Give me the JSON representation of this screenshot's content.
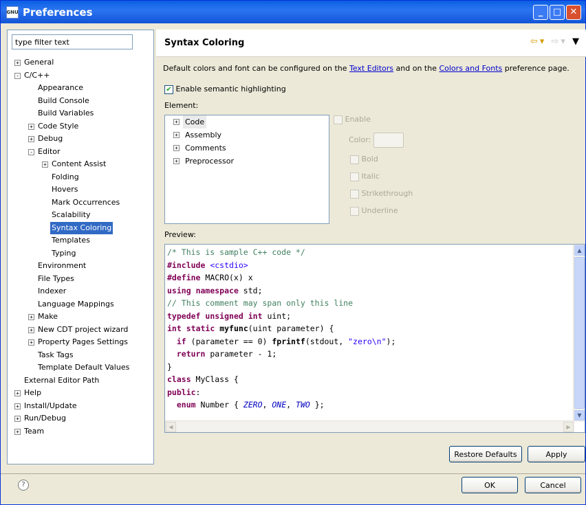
{
  "window": {
    "title": "Preferences",
    "app_icon": "app-icon-gnu",
    "controls": [
      "minimize",
      "maximize",
      "close"
    ]
  },
  "filter": {
    "placeholder": "type filter text",
    "value": "type filter text"
  },
  "tree": [
    {
      "label": "General",
      "level": 0,
      "expander": "+"
    },
    {
      "label": "C/C++",
      "level": 0,
      "expander": "-"
    },
    {
      "label": "Appearance",
      "level": 1
    },
    {
      "label": "Build Console",
      "level": 1
    },
    {
      "label": "Build Variables",
      "level": 1
    },
    {
      "label": "Code Style",
      "level": 1,
      "expander": "+"
    },
    {
      "label": "Debug",
      "level": 1,
      "expander": "+"
    },
    {
      "label": "Editor",
      "level": 1,
      "expander": "-"
    },
    {
      "label": "Content Assist",
      "level": 2,
      "expander": "+"
    },
    {
      "label": "Folding",
      "level": 2
    },
    {
      "label": "Hovers",
      "level": 2
    },
    {
      "label": "Mark Occurrences",
      "level": 2
    },
    {
      "label": "Scalability",
      "level": 2
    },
    {
      "label": "Syntax Coloring",
      "level": 2,
      "selected": true
    },
    {
      "label": "Templates",
      "level": 2
    },
    {
      "label": "Typing",
      "level": 2
    },
    {
      "label": "Environment",
      "level": 1
    },
    {
      "label": "File Types",
      "level": 1
    },
    {
      "label": "Indexer",
      "level": 1
    },
    {
      "label": "Language Mappings",
      "level": 1
    },
    {
      "label": "Make",
      "level": 1,
      "expander": "+"
    },
    {
      "label": "New CDT project wizard",
      "level": 1,
      "expander": "+"
    },
    {
      "label": "Property Pages Settings",
      "level": 1,
      "expander": "+"
    },
    {
      "label": "Task Tags",
      "level": 1
    },
    {
      "label": "Template Default Values",
      "level": 1
    },
    {
      "label": "External Editor Path",
      "level": 0
    },
    {
      "label": "Help",
      "level": 0,
      "expander": "+"
    },
    {
      "label": "Install/Update",
      "level": 0,
      "expander": "+"
    },
    {
      "label": "Run/Debug",
      "level": 0,
      "expander": "+"
    },
    {
      "label": "Team",
      "level": 0,
      "expander": "+"
    }
  ],
  "page": {
    "title": "Syntax Coloring",
    "desc_prefix": "Default colors and font can be configured on the ",
    "desc_link1": "Text Editors",
    "desc_mid": " and on the ",
    "desc_link2": "Colors and Fonts",
    "desc_suffix": " preference page.",
    "semantic_label": "Enable semantic highlighting",
    "semantic_checked": true,
    "element_label": "Element:",
    "elements": [
      "Code",
      "Assembly",
      "Comments",
      "Preprocessor"
    ],
    "options": {
      "enable": "Enable",
      "color": "Color:",
      "bold": "Bold",
      "italic": "Italic",
      "strikethrough": "Strikethrough",
      "underline": "Underline"
    },
    "preview_label": "Preview:",
    "preview_lines": [
      [
        [
          "c-com",
          "/* This is sample C++ code */"
        ]
      ],
      [
        [
          "c-pp",
          "#include"
        ],
        [
          "",
          " "
        ],
        [
          "c-inc",
          "<cstdio>"
        ]
      ],
      [
        [
          "c-pp",
          "#define"
        ],
        [
          "",
          " MACRO(x) x"
        ]
      ],
      [
        [
          "c-kw",
          "using"
        ],
        [
          "",
          " "
        ],
        [
          "c-kw",
          "namespace"
        ],
        [
          "",
          " std;"
        ]
      ],
      [
        [
          "c-com",
          "// This comment may span only this line"
        ]
      ],
      [
        [
          "c-kw",
          "typedef"
        ],
        [
          "",
          " "
        ],
        [
          "c-kw",
          "unsigned"
        ],
        [
          "",
          " "
        ],
        [
          "c-kw",
          "int"
        ],
        [
          "",
          " uint;"
        ]
      ],
      [
        [
          "c-kw",
          "int"
        ],
        [
          "",
          " "
        ],
        [
          "c-kw",
          "static"
        ],
        [
          "",
          " "
        ],
        [
          "c-fn",
          "myfunc"
        ],
        [
          "",
          "(uint parameter) {"
        ]
      ],
      [
        [
          "",
          "  "
        ],
        [
          "c-kw",
          "if"
        ],
        [
          "",
          " (parameter == 0) "
        ],
        [
          "c-fn",
          "fprintf"
        ],
        [
          "",
          "(stdout, "
        ],
        [
          "c-str",
          "\"zero\\n\""
        ],
        [
          "",
          ");"
        ]
      ],
      [
        [
          "",
          "  "
        ],
        [
          "c-kw",
          "return"
        ],
        [
          "",
          " parameter - 1;"
        ]
      ],
      [
        [
          "",
          "}"
        ]
      ],
      [
        [
          "c-kw",
          "class"
        ],
        [
          "",
          " MyClass {"
        ]
      ],
      [
        [
          "c-kw",
          "public"
        ],
        [
          "",
          ":"
        ]
      ],
      [
        [
          "",
          "  "
        ],
        [
          "c-kw",
          "enum"
        ],
        [
          "",
          " Number { "
        ],
        [
          "c-en",
          "ZERO"
        ],
        [
          "",
          ", "
        ],
        [
          "c-en",
          "ONE"
        ],
        [
          "",
          ", "
        ],
        [
          "c-en",
          "TWO"
        ],
        [
          "",
          " };"
        ]
      ]
    ]
  },
  "buttons": {
    "restore": "Restore Defaults",
    "apply": "Apply",
    "ok": "OK",
    "cancel": "Cancel",
    "help": "?"
  }
}
